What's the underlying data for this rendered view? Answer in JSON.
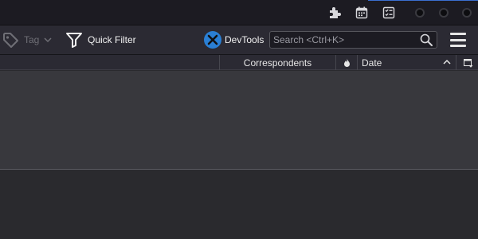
{
  "titlebar": {
    "icons": [
      "extensions-icon",
      "calendar-icon",
      "tasks-icon"
    ],
    "window_controls": [
      "minimize-button",
      "maximize-button",
      "close-button"
    ]
  },
  "toolbar": {
    "tag_label": "Tag",
    "quick_filter_label": "Quick Filter",
    "devtools_label": "DevTools",
    "search_placeholder": "Search <Ctrl+K>"
  },
  "columns": {
    "correspondents": "Correspondents",
    "date": "Date"
  },
  "colors": {
    "titlebar": "#1c1b22",
    "toolbar": "#2b2a33",
    "thread_pane": "#38383d",
    "devtools_accent": "#2a7fd4"
  }
}
